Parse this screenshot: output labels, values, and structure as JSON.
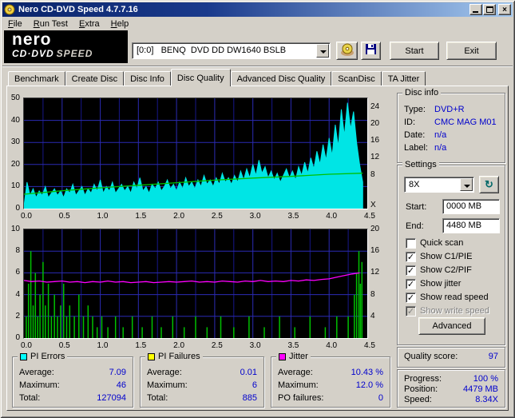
{
  "titlebar": {
    "title": "Nero CD-DVD Speed 4.7.7.16"
  },
  "menubar": {
    "items": [
      "File",
      "Run Test",
      "Extra",
      "Help"
    ]
  },
  "toolbar": {
    "logo_line1": "nero",
    "logo_line2a": "CD·DVD",
    "logo_line2b": "SPEED",
    "drive_value": "[0:0]   BENQ  DVD DD DW1640 BSLB",
    "start_label": "Start",
    "exit_label": "Exit"
  },
  "tabs": {
    "items": [
      "Benchmark",
      "Create Disc",
      "Disc Info",
      "Disc Quality",
      "Advanced Disc Quality",
      "ScanDisc",
      "TA Jitter"
    ],
    "active": "Disc Quality"
  },
  "disc_info": {
    "title": "Disc info",
    "rows": [
      {
        "label": "Type:",
        "value": "DVD+R"
      },
      {
        "label": "ID:",
        "value": "CMC MAG M01"
      },
      {
        "label": "Date:",
        "value": "n/a"
      },
      {
        "label": "Label:",
        "value": "n/a"
      }
    ]
  },
  "settings": {
    "title": "Settings",
    "speed_value": "8X",
    "start_label": "Start:",
    "start_value": "0000 MB",
    "end_label": "End:",
    "end_value": "4480 MB",
    "checkboxes": [
      {
        "label": "Quick scan",
        "checked": false,
        "disabled": false
      },
      {
        "label": "Show C1/PIE",
        "checked": true,
        "disabled": false
      },
      {
        "label": "Show C2/PIF",
        "checked": true,
        "disabled": false
      },
      {
        "label": "Show jitter",
        "checked": true,
        "disabled": false
      },
      {
        "label": "Show read speed",
        "checked": true,
        "disabled": false
      },
      {
        "label": "Show write speed",
        "checked": true,
        "disabled": true
      }
    ],
    "advanced_label": "Advanced"
  },
  "quality": {
    "label": "Quality score:",
    "value": "97"
  },
  "progress": {
    "rows": [
      {
        "label": "Progress:",
        "value": "100 %"
      },
      {
        "label": "Position:",
        "value": "4479 MB"
      },
      {
        "label": "Speed:",
        "value": "8.34X"
      }
    ]
  },
  "stats": [
    {
      "title": "PI Errors",
      "swatch": "#00ffff",
      "rows": [
        {
          "label": "Average:",
          "value": "7.09"
        },
        {
          "label": "Maximum:",
          "value": "46"
        },
        {
          "label": "Total:",
          "value": "127094"
        }
      ]
    },
    {
      "title": "PI Failures",
      "swatch": "#ffff00",
      "rows": [
        {
          "label": "Average:",
          "value": "0.01"
        },
        {
          "label": "Maximum:",
          "value": "6"
        },
        {
          "label": "Total:",
          "value": "885"
        }
      ]
    },
    {
      "title": "Jitter",
      "swatch": "#ff00ff",
      "rows": [
        {
          "label": "Average:",
          "value": "10.43 %"
        },
        {
          "label": "Maximum:",
          "value": "12.0 %"
        },
        {
          "label": "PO failures:",
          "value": "0"
        }
      ]
    }
  ],
  "icons": {
    "check": "✓",
    "close": "×",
    "refresh": "↻"
  },
  "colors": {
    "value_text": "#0000cd",
    "pi_errors": "#00e5e5",
    "pi_failures": "#00c000",
    "jitter": "#ff00ff",
    "read_speed": "#00c000",
    "grid": "#2b2bb4"
  },
  "chart_data": [
    {
      "name": "PI Errors and read speed",
      "type": "area",
      "xlim": [
        0,
        4.5
      ],
      "x_ticks": [
        "0.0",
        "0.5",
        "1.0",
        "1.5",
        "2.0",
        "2.5",
        "3.0",
        "3.5",
        "4.0",
        "4.5"
      ],
      "grid_step_x": 0.25,
      "left_axis": {
        "lim": [
          0,
          50
        ],
        "ticks": [
          0,
          10,
          20,
          30,
          40,
          50
        ]
      },
      "right_axis": {
        "lim": [
          0,
          26
        ],
        "ticks": [
          8,
          12,
          16,
          20,
          24
        ],
        "unit": "X"
      },
      "series": [
        {
          "name": "PI Errors",
          "kind": "area",
          "axis": "left",
          "color": "#00e5e5",
          "x0": 0,
          "dx": 0.04,
          "values": [
            1,
            12,
            6,
            9,
            5,
            8,
            6,
            10,
            5,
            7,
            9,
            6,
            8,
            5,
            9,
            7,
            11,
            6,
            8,
            10,
            6,
            9,
            7,
            11,
            8,
            13,
            7,
            10,
            8,
            12,
            7,
            9,
            11,
            8,
            10,
            7,
            12,
            9,
            14,
            8,
            10,
            7,
            11,
            9,
            12,
            8,
            10,
            13,
            9,
            11,
            8,
            12,
            9,
            14,
            10,
            12,
            9,
            13,
            10,
            15,
            11,
            13,
            10,
            14,
            11,
            16,
            12,
            14,
            11,
            15,
            12,
            17,
            13,
            18,
            14,
            20,
            15,
            22,
            16,
            19,
            14,
            17,
            13,
            16,
            12,
            15,
            18,
            14,
            17,
            13,
            19,
            15,
            21,
            16,
            23,
            18,
            26,
            20,
            29,
            22,
            32,
            24,
            38,
            28,
            45,
            33,
            48,
            36,
            44,
            30,
            20,
            12
          ]
        },
        {
          "name": "Read speed",
          "kind": "line",
          "axis": "right",
          "color": "#00c000",
          "points": [
            [
              0,
              3.4
            ],
            [
              0.5,
              4.2
            ],
            [
              1.0,
              4.9
            ],
            [
              1.5,
              5.5
            ],
            [
              2.0,
              6.1
            ],
            [
              2.5,
              6.7
            ],
            [
              3.0,
              7.2
            ],
            [
              3.5,
              7.6
            ],
            [
              4.0,
              8.1
            ],
            [
              4.44,
              8.34
            ]
          ]
        }
      ]
    },
    {
      "name": "PI Failures and jitter",
      "type": "line",
      "xlim": [
        0,
        4.5
      ],
      "x_ticks": [
        "0.0",
        "0.5",
        "1.0",
        "1.5",
        "2.0",
        "2.5",
        "3.0",
        "3.5",
        "4.0",
        "4.5"
      ],
      "grid_step_x": 0.25,
      "left_axis": {
        "lim": [
          0,
          10
        ],
        "ticks": [
          0,
          2,
          4,
          6,
          8,
          10
        ]
      },
      "right_axis": {
        "lim": [
          0,
          20
        ],
        "ticks": [
          4,
          8,
          12,
          16,
          20
        ]
      },
      "series": [
        {
          "name": "PI Failures",
          "kind": "spikes",
          "axis": "left",
          "color": "#00c000",
          "points": [
            [
              0.03,
              2
            ],
            [
              0.06,
              5
            ],
            [
              0.09,
              8
            ],
            [
              0.12,
              3
            ],
            [
              0.15,
              6
            ],
            [
              0.18,
              2
            ],
            [
              0.21,
              4
            ],
            [
              0.25,
              7
            ],
            [
              0.28,
              3
            ],
            [
              0.32,
              5
            ],
            [
              0.36,
              2
            ],
            [
              0.4,
              4
            ],
            [
              0.44,
              2
            ],
            [
              0.48,
              3
            ],
            [
              0.52,
              5
            ],
            [
              0.56,
              2
            ],
            [
              0.6,
              3
            ],
            [
              0.66,
              2
            ],
            [
              0.72,
              4
            ],
            [
              0.78,
              2
            ],
            [
              0.84,
              3
            ],
            [
              0.9,
              2
            ],
            [
              0.96,
              1
            ],
            [
              1.02,
              2
            ],
            [
              1.1,
              1
            ],
            [
              1.2,
              2
            ],
            [
              1.3,
              1
            ],
            [
              1.42,
              2
            ],
            [
              1.55,
              1
            ],
            [
              1.68,
              2
            ],
            [
              1.8,
              1
            ],
            [
              1.95,
              2
            ],
            [
              2.1,
              1
            ],
            [
              2.25,
              2
            ],
            [
              2.4,
              1
            ],
            [
              2.58,
              2
            ],
            [
              2.75,
              1
            ],
            [
              2.95,
              2
            ],
            [
              3.15,
              1
            ],
            [
              3.35,
              2
            ],
            [
              3.55,
              1
            ],
            [
              3.75,
              2
            ],
            [
              3.95,
              1
            ],
            [
              4.1,
              2
            ],
            [
              4.25,
              2
            ],
            [
              4.33,
              4
            ],
            [
              4.36,
              6
            ],
            [
              4.39,
              8
            ],
            [
              4.41,
              5
            ],
            [
              4.43,
              7
            ]
          ]
        },
        {
          "name": "Jitter",
          "kind": "line",
          "axis": "right",
          "color": "#ff00ff",
          "x0": 0,
          "dx": 0.1,
          "values": [
            10.6,
            10.4,
            10.5,
            10.3,
            10.4,
            10.5,
            10.3,
            10.4,
            10.2,
            10.4,
            10.3,
            10.5,
            10.3,
            10.4,
            10.2,
            10.3,
            10.4,
            10.2,
            10.3,
            10.4,
            10.3,
            10.4,
            10.5,
            10.3,
            10.4,
            10.3,
            10.5,
            10.4,
            10.3,
            10.5,
            10.4,
            10.6,
            10.4,
            10.5,
            10.4,
            10.6,
            10.5,
            10.7,
            10.6,
            10.8,
            10.9,
            11.2,
            11.5,
            11.8,
            12.0
          ]
        }
      ]
    }
  ]
}
